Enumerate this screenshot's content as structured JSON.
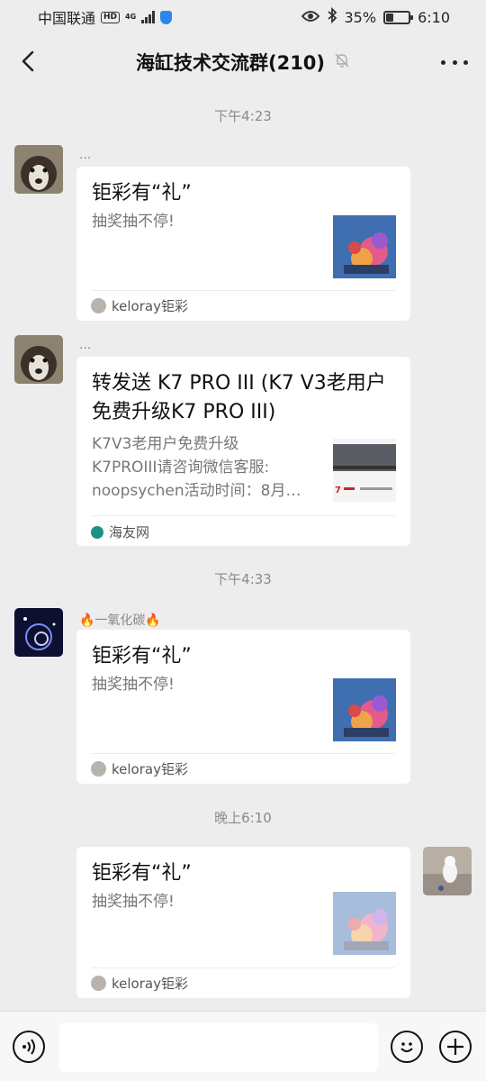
{
  "status": {
    "carrier": "中国联通",
    "hd": "HD",
    "net": "4G",
    "battery": "35%",
    "time": "6:10"
  },
  "header": {
    "title": "海缸技术交流群(210)"
  },
  "messages": [
    {
      "time": "下午4:23",
      "nick": "...",
      "title": "钜彩有“礼”",
      "desc": "抽奖抽不停!",
      "source": "keloray钜彩"
    },
    {
      "nick": "...",
      "title": "转发送 K7 PRO III (K7 V3老用户免费升级K7 PRO III)",
      "desc_lines": [
        "K7V3老用户免费升级",
        "K7PROIII请咨询微信客服:",
        "noopsychen活动时间：8月…"
      ],
      "source": "海友网"
    },
    {
      "time": "下午4:33",
      "nick": "🔥一氧化碳🔥",
      "title": "钜彩有“礼”",
      "desc": "抽奖抽不停!",
      "source": "keloray钜彩"
    },
    {
      "time": "晚上6:10",
      "title": "钜彩有“礼”",
      "desc": "抽奖抽不停!",
      "source": "keloray钜彩"
    }
  ],
  "icons": {
    "back": "chevron-left-icon",
    "mute": "bell-off-icon",
    "more": "more-dots-icon",
    "voice": "voice-icon",
    "emoji": "emoji-icon",
    "plus": "plus-icon"
  },
  "colors": {
    "background": "#ededed",
    "card": "#ffffff",
    "meta_text": "#8a8a8a"
  }
}
